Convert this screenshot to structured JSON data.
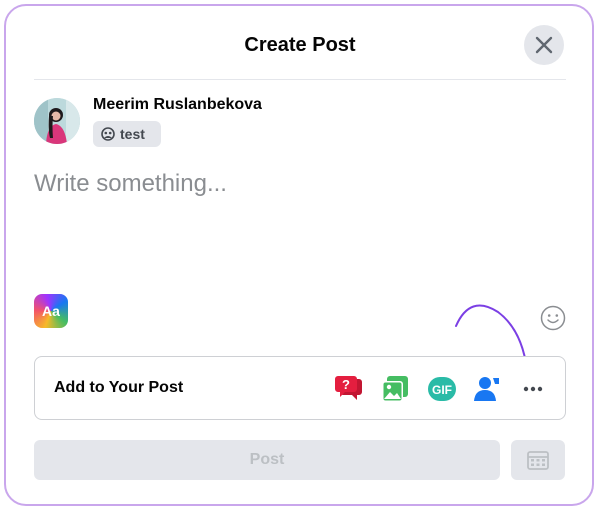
{
  "dialog": {
    "title": "Create Post"
  },
  "user": {
    "name": "Meerim Ruslanbekova",
    "audience_label": "test"
  },
  "composer": {
    "placeholder": "Write something..."
  },
  "text_format": {
    "label": "Aa"
  },
  "add_to_post": {
    "label": "Add to Your Post",
    "icons": [
      "question-icon",
      "photo-icon",
      "gif-icon",
      "tag-people-icon",
      "more-icon"
    ],
    "gif_text": "GIF",
    "more_text": "•••"
  },
  "actions": {
    "post_label": "Post"
  },
  "colors": {
    "border_accent": "#c9a6ec",
    "question_red": "#e41e3f",
    "photo_green": "#45bd62",
    "gif_teal": "#2abba7",
    "tag_blue": "#1877f2",
    "annotation_arrow": "#7b3fe4"
  }
}
